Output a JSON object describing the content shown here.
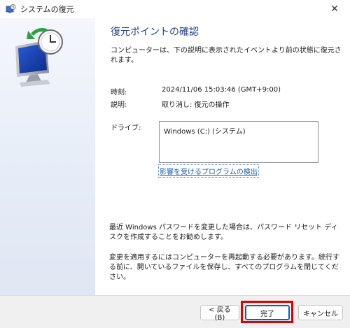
{
  "window": {
    "title": "システムの復元",
    "close_glyph": "✕"
  },
  "content": {
    "heading": "復元ポイントの確認",
    "description": "コンピューターは、下の説明に表示されたイベントより前の状態に復元されます。",
    "time_label": "時刻:",
    "time_value": "2024/11/06 15:03:46 (GMT+9:00)",
    "description_label": "説明:",
    "description_value": "取り消し: 復元の操作",
    "drives_label": "ドライブ:",
    "drives": [
      "Windows (C:) (システム)"
    ],
    "affected_programs_link": "影響を受けるプログラムの検出",
    "password_note": "最近 Windows パスワードを変更した場合は、パスワード リセット ディスクを作成することをお勧めします。",
    "restart_note": "変更を適用するにはコンピューターを再起動する必要があります。続行する前に、開いているファイルを保存し、すべてのプログラムを閉じてください。"
  },
  "footer": {
    "back_label": "< 戻る(B)",
    "finish_label": "完了",
    "cancel_label": "キャンセル"
  },
  "colors": {
    "heading": "#1e3f8a",
    "link": "#1a5fb4",
    "highlight": "#e00000",
    "default_button_border": "#0067c0"
  },
  "icons": {
    "title_icon": "system-restore-icon",
    "side_art": "monitor-restore-clock-icon"
  }
}
